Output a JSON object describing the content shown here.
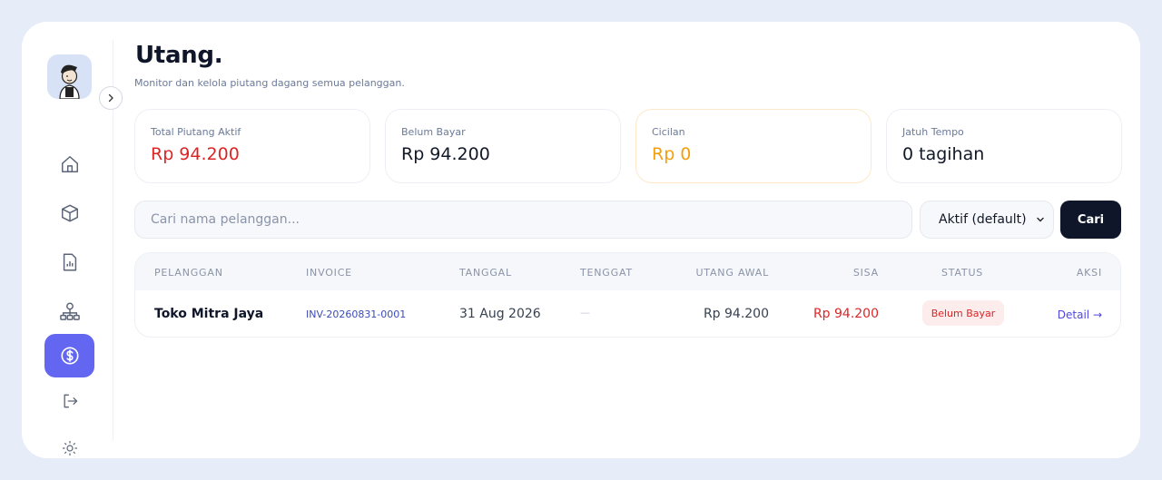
{
  "header": {
    "title": "Utang.",
    "subtitle": "Monitor dan kelola piutang dagang semua pelanggan."
  },
  "colors": {
    "accent": "#6366f1",
    "danger": "#dc2626",
    "warning": "#f59e0b",
    "dark": "#0f1629"
  },
  "sidebar": {
    "items": [
      {
        "icon": "home-icon",
        "active": false
      },
      {
        "icon": "box-icon",
        "active": false
      },
      {
        "icon": "report-icon",
        "active": false
      },
      {
        "icon": "users-icon",
        "active": false
      },
      {
        "icon": "dollar-icon",
        "active": true
      },
      {
        "icon": "logout-icon",
        "active": false
      },
      {
        "icon": "sun-icon",
        "active": false
      }
    ]
  },
  "stats": [
    {
      "label": "Total Piutang Aktif",
      "value": "Rp 94.200"
    },
    {
      "label": "Belum Bayar",
      "value": "Rp 94.200"
    },
    {
      "label": "Cicilan",
      "value": "Rp 0"
    },
    {
      "label": "Jatuh Tempo",
      "value": "0 tagihan"
    }
  ],
  "filter": {
    "search_placeholder": "Cari nama pelanggan...",
    "search_value": "",
    "status_selected": "Aktif (default)",
    "search_button": "Cari"
  },
  "table": {
    "columns": [
      "PELANGGAN",
      "INVOICE",
      "TANGGAL",
      "TENGGAT",
      "UTANG AWAL",
      "SISA",
      "STATUS",
      "AKSI"
    ],
    "rows": [
      {
        "pelanggan": "Toko Mitra Jaya",
        "invoice": "INV-20260831-0001",
        "tanggal": "31 Aug 2026",
        "tenggat": "—",
        "utang_awal": "Rp 94.200",
        "sisa": "Rp 94.200",
        "status": "Belum Bayar",
        "aksi": "Detail →"
      }
    ]
  }
}
